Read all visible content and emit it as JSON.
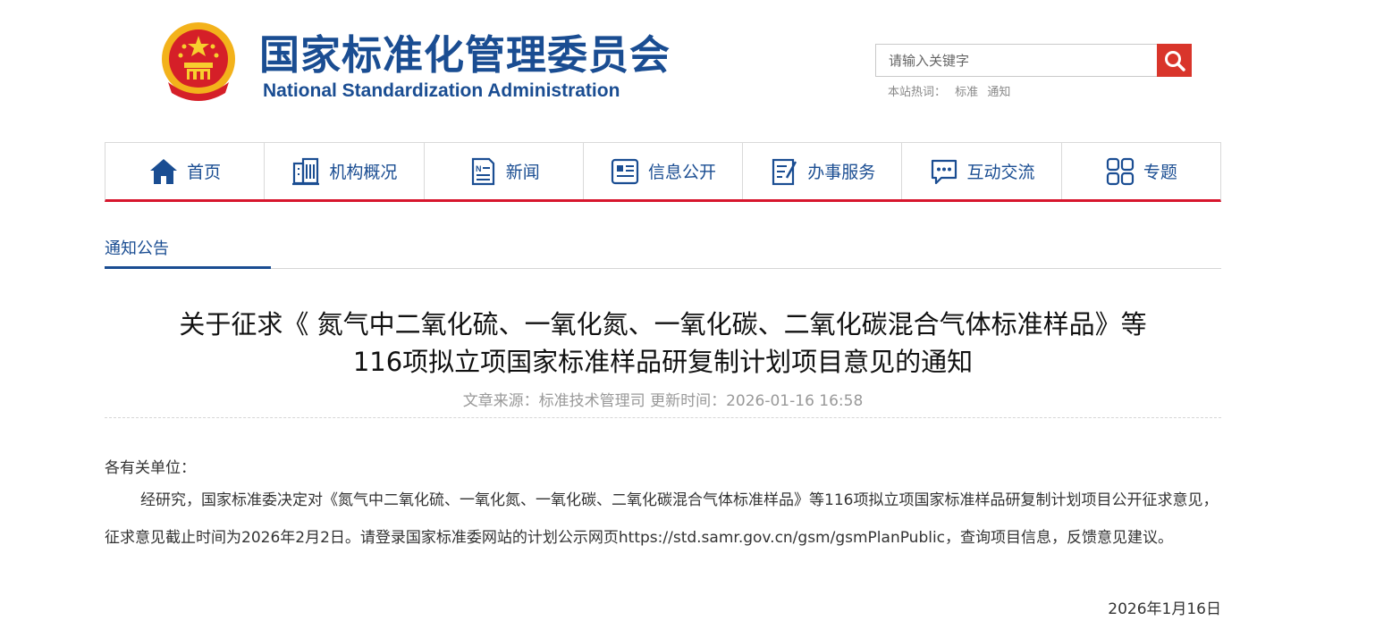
{
  "header": {
    "title_cn": "国家标准化管理委员会",
    "title_en": "National Standardization Administration",
    "colors": {
      "brand_blue": "#1a4d92",
      "accent_red": "#d7162d"
    }
  },
  "search": {
    "placeholder": "请输入关键字",
    "hot_label": "本站热词：",
    "hot_words": [
      "标准",
      "通知"
    ]
  },
  "nav": {
    "items": [
      {
        "label": "首页",
        "icon": "home-icon"
      },
      {
        "label": "机构概况",
        "icon": "building-icon"
      },
      {
        "label": "新闻",
        "icon": "news-icon"
      },
      {
        "label": "信息公开",
        "icon": "info-icon"
      },
      {
        "label": "办事服务",
        "icon": "service-icon"
      },
      {
        "label": "互动交流",
        "icon": "chat-icon"
      },
      {
        "label": "专题",
        "icon": "grid-icon"
      }
    ]
  },
  "section": {
    "tab": "通知公告"
  },
  "article": {
    "title_line1": "关于征求《 氮气中二氧化硫、一氧化氮、一氧化碳、二氧化碳混合气体标准样品》等",
    "title_line2": "116项拟立项国家标准样品研复制计划项目意见的通知",
    "meta": "文章来源：标准技术管理司 更新时间：2026-01-16 16:58",
    "salutation": "各有关单位：",
    "body_part1": "经研究，国家标准委决定对《氮气中二氧化硫、一氧化氮、一氧化碳、二氧化碳混合气体标准样品》等116项拟立项国家标准样品研复制计划项目公开征求意见，征求意见截止时间为2026年2月2日。请登录国家标准委网站的计划公示网页",
    "link": "https://std.samr.gov.cn/gsm/gsmPlanPublic",
    "body_part2": "，查询项目信息，反馈意见建议。",
    "date": "2026年1月16日"
  }
}
